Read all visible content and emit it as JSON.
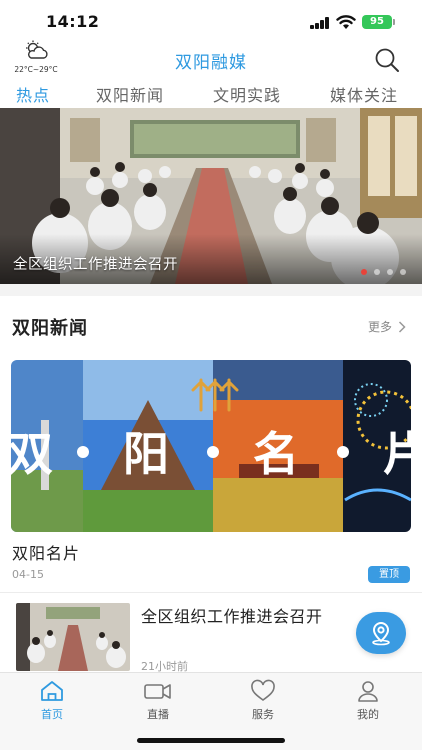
{
  "status_bar": {
    "time": "14:12",
    "battery": "95"
  },
  "header": {
    "weather_temp": "22°C~29°C",
    "title": "双阳融媒",
    "icons": {
      "weather": "partly-cloudy-icon",
      "search": "search-icon"
    }
  },
  "tabs": [
    {
      "label": "热点",
      "active": true
    },
    {
      "label": "双阳新闻",
      "active": false
    },
    {
      "label": "文明实践",
      "active": false
    },
    {
      "label": "媒体关注",
      "active": false
    }
  ],
  "banner": {
    "caption": "全区组织工作推进会召开",
    "slide_count": 4,
    "active_slide": 1
  },
  "section": {
    "title": "双阳新闻",
    "more_label": "更多"
  },
  "feature": {
    "title": "双阳名片",
    "date": "04-15",
    "badge": "置顶",
    "image_text": [
      "双",
      "阳",
      "名",
      "片"
    ]
  },
  "news": [
    {
      "title": "全区组织工作推进会召开",
      "time": "21小时前"
    }
  ],
  "tabbar": [
    {
      "label": "首页",
      "icon": "home-icon",
      "active": true
    },
    {
      "label": "直播",
      "icon": "camera-icon",
      "active": false
    },
    {
      "label": "服务",
      "icon": "heart-icon",
      "active": false
    },
    {
      "label": "我的",
      "icon": "user-icon",
      "active": false
    }
  ],
  "colors": {
    "accent": "#2f9ae0",
    "badge": "#3a9be2",
    "active_dot": "#e8433a"
  }
}
